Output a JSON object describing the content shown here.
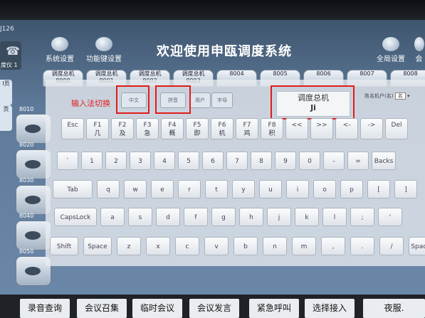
{
  "device_id": "J126",
  "title": "欢迎使用申瓯调度系统",
  "top_icons": {
    "system_settings": "系统设置",
    "function_keys": "功能键设置",
    "global_settings": "全局设置",
    "extra": "会"
  },
  "left_phone_label": "度仪 1",
  "side_labels": [
    "I页",
    "页"
  ],
  "tabs": [
    {
      "label": "调度总机",
      "num": "8000"
    },
    {
      "label": "调度总机",
      "num": "8001"
    },
    {
      "label": "调度总机",
      "num": "8002"
    },
    {
      "label": "调度总机",
      "num": "8003"
    },
    {
      "label": "",
      "num": "8004"
    },
    {
      "label": "",
      "num": "8005"
    },
    {
      "label": "",
      "num": "8006"
    },
    {
      "label": "",
      "num": "8007"
    },
    {
      "label": "",
      "num": "8008"
    }
  ],
  "tile_labels": [
    "8010",
    "8020",
    "8030",
    "8040",
    "8050"
  ],
  "keyboard": {
    "mode_label": "输入法切换",
    "mode_buttons": [
      "中文",
      "拼音",
      "用户",
      "字母"
    ],
    "composition": {
      "text": "调度总机",
      "pinyin": "Ji"
    },
    "dictionary_label": "姓名机户(名)",
    "dictionary_value": "名",
    "row_fn": [
      {
        "key": "Esc",
        "sub": ""
      },
      {
        "key": "F1",
        "sub": "几"
      },
      {
        "key": "F2",
        "sub": "及"
      },
      {
        "key": "F3",
        "sub": "急"
      },
      {
        "key": "F4",
        "sub": "概"
      },
      {
        "key": "F5",
        "sub": "即"
      },
      {
        "key": "F6",
        "sub": "机"
      },
      {
        "key": "F7",
        "sub": "鸡"
      },
      {
        "key": "F8",
        "sub": "积"
      },
      {
        "key": "<<",
        "sub": ""
      },
      {
        "key": ">>",
        "sub": ""
      },
      {
        "key": "<-",
        "sub": ""
      },
      {
        "key": "->",
        "sub": ""
      },
      {
        "key": "Del",
        "sub": ""
      }
    ],
    "row_num": [
      "`",
      "1",
      "2",
      "3",
      "4",
      "5",
      "6",
      "7",
      "8",
      "9",
      "0",
      "-",
      "=",
      "Backs"
    ],
    "row_q": [
      "Tab",
      "q",
      "w",
      "e",
      "r",
      "t",
      "y",
      "u",
      "i",
      "o",
      "p",
      "[",
      "]"
    ],
    "row_a": [
      "CapsLock",
      "a",
      "s",
      "d",
      "f",
      "g",
      "h",
      "j",
      "k",
      "l",
      ";",
      "'"
    ],
    "row_z": [
      "Shift",
      "Space",
      "z",
      "x",
      "c",
      "v",
      "b",
      "n",
      "m",
      ",",
      ".",
      "/",
      "Space"
    ]
  },
  "bottom_buttons": [
    "录音查询",
    "会议召集",
    "临时会议",
    "会议发言",
    "紧急呼叫",
    "选择接入",
    "夜服."
  ]
}
